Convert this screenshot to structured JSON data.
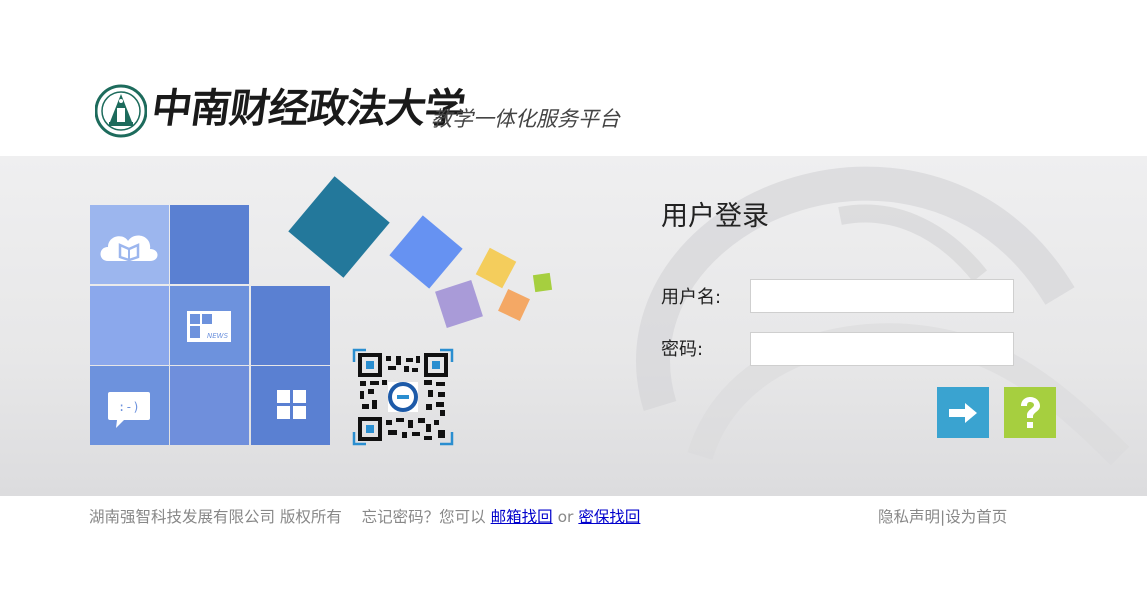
{
  "header": {
    "university_name": "中南财经政法大学",
    "platform_name": "教学一体化服务平台"
  },
  "login": {
    "title": "用户登录",
    "username_label": "用户名:",
    "username_value": "",
    "password_label": "密码:",
    "password_value": "",
    "login_button_icon": "arrow-right-icon",
    "help_button_icon": "question-mark-icon"
  },
  "tiles": {
    "icons": [
      "cloud-book-icon",
      "news-icon",
      "chat-bubble-icon",
      "grid-apps-icon"
    ],
    "news_caption": "NEWS",
    "chat_caption": ":-)"
  },
  "footer": {
    "copyright": "湖南强智科技发展有限公司 版权所有",
    "forgot_prefix": "忘记密码？您可以",
    "email_recover": "邮箱找回",
    "or_text": "or",
    "security_recover": "密保找回",
    "privacy": "隐私声明",
    "separator": "|",
    "set_homepage": "设为首页"
  },
  "colors": {
    "tile_light": "#8aa8e8",
    "tile_mid": "#6b8fdc",
    "tile_dark": "#5a7ed0",
    "login_button": "#3aa3d0",
    "help_button": "#a6cf3f"
  }
}
